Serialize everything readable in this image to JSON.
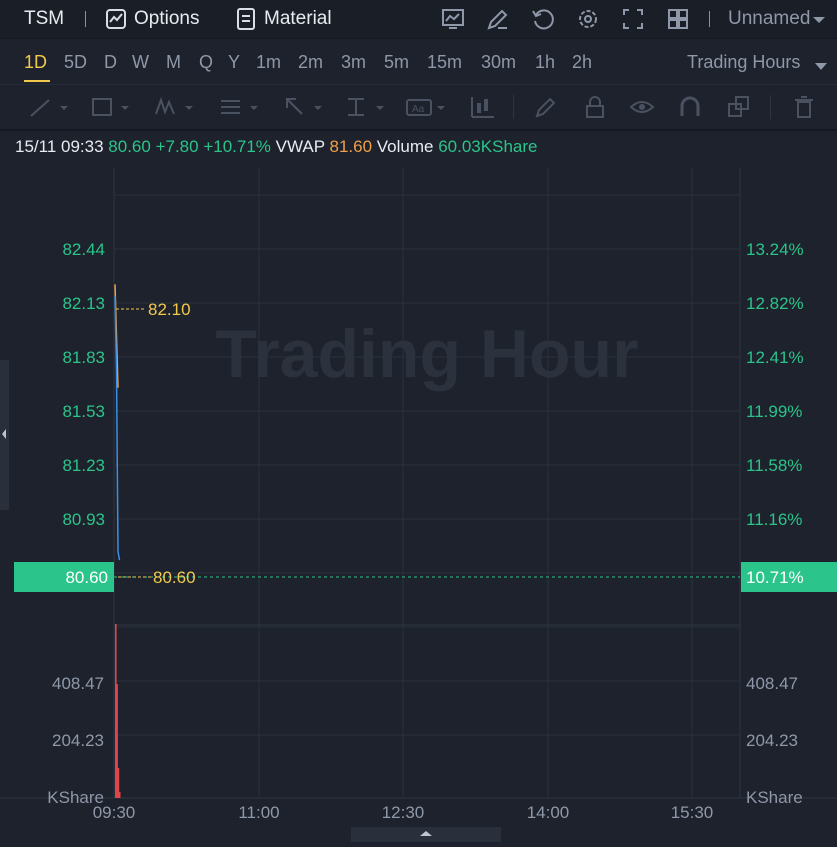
{
  "toolbar": {
    "symbol": "TSM",
    "options_label": "Options",
    "material_label": "Material",
    "layout_name": "Unnamed"
  },
  "timeframes": {
    "items": [
      "1D",
      "5D",
      "D",
      "W",
      "M",
      "Q",
      "Y",
      "1m",
      "2m",
      "3m",
      "5m",
      "15m",
      "30m",
      "1h",
      "2h"
    ],
    "active": "1D",
    "session_label": "Trading Hours"
  },
  "drawing_tools": [
    "trendline-icon",
    "rectangle-icon",
    "pattern-icon",
    "fib-icon",
    "arrow-icon",
    "measure-icon",
    "text-icon",
    "bars-icon",
    "pencil-icon",
    "lock-icon",
    "eye-icon",
    "magnet-icon",
    "layers-icon",
    "trash-icon"
  ],
  "info": {
    "datetime": "15/11 09:33",
    "price": "80.60",
    "change": "+7.80",
    "change_pct": "+10.71%",
    "vwap_label": "VWAP",
    "vwap": "81.60",
    "volume_label": "Volume",
    "volume": "60.03KShare"
  },
  "watermark": "Trading Hour",
  "colors": {
    "up": "#2bc48a",
    "accent": "#f2c94c",
    "vwap": "#f0a04a",
    "price_line": "#3a8ee6",
    "volume_bar": "#e0454a"
  },
  "chart_data": {
    "type": "line",
    "x_ticks": [
      "09:30",
      "11:00",
      "12:30",
      "14:00",
      "15:30"
    ],
    "price_ticks_left": [
      "82.44",
      "82.13",
      "81.83",
      "81.53",
      "81.23",
      "80.93"
    ],
    "pct_ticks_right": [
      "13.24%",
      "12.82%",
      "12.41%",
      "11.99%",
      "11.58%",
      "11.16%"
    ],
    "last_price_label": "80.60",
    "last_pct_label": "10.71%",
    "high_marker": "82.10",
    "last_marker": "80.60",
    "price_series": {
      "x": [
        "09:30",
        "09:31",
        "09:32",
        "09:33"
      ],
      "values": [
        82.13,
        81.7,
        80.65,
        80.6
      ]
    },
    "vwap_series": {
      "x": [
        "09:30",
        "09:31",
        "09:32"
      ],
      "values": [
        82.2,
        81.9,
        81.6
      ]
    },
    "volume_ticks": [
      "408.47",
      "204.23"
    ],
    "volume_unit": "KShare",
    "volume_series": {
      "x": [
        "09:30",
        "09:31",
        "09:32",
        "09:33"
      ],
      "values": [
        580,
        380,
        100,
        20
      ]
    },
    "price_ylim": [
      80.45,
      82.55
    ],
    "volume_ylim": [
      0,
      560
    ]
  }
}
